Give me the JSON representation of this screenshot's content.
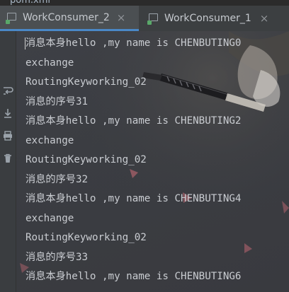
{
  "top_file": "pom.xml",
  "tabs": [
    {
      "label": "WorkConsumer_2",
      "active": true
    },
    {
      "label": "WorkConsumer_1",
      "active": false
    }
  ],
  "tab_close_glyph": "×",
  "gutter_icons": [
    "wrap-icon",
    "scroll-to-end-icon",
    "print-icon",
    "trash-icon"
  ],
  "console": {
    "lines": [
      "消息本身hello ,my name is CHENBUTING0",
      "exchange",
      "RoutingKeyworking_02",
      "消息的序号31",
      "消息本身hello ,my name is CHENBUTING2",
      "exchange",
      "RoutingKeyworking_02",
      "消息的序号32",
      "消息本身hello ,my name is CHENBUTING4",
      "exchange",
      "RoutingKeyworking_02",
      "消息的序号33",
      "消息本身hello ,my name is CHENBUTING6"
    ]
  },
  "colors": {
    "tab_active_bg": "#4b4f52",
    "tab_underline": "#4a88c7",
    "console_text": "#c9ccd1",
    "run_indicator": "#59a869"
  }
}
